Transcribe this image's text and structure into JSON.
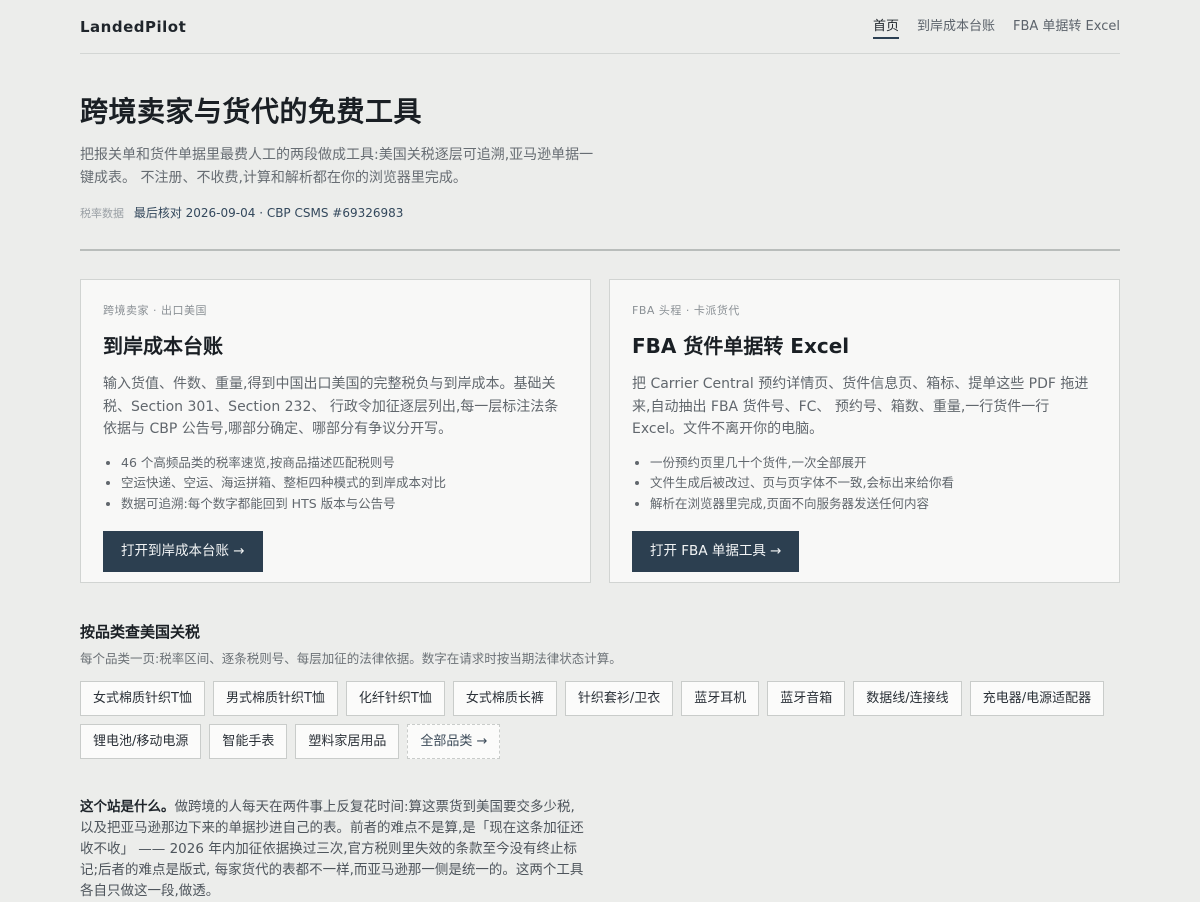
{
  "header": {
    "brand": "LandedPilot",
    "nav": [
      {
        "label": "首页"
      },
      {
        "label": "到岸成本台账"
      },
      {
        "label": "FBA 单据转 Excel"
      }
    ]
  },
  "hero": {
    "title": "跨境卖家与货代的免费工具",
    "lede": "把报关单和货件单据里最费人工的两段做成工具:美国关税逐层可追溯,亚马逊单据一键成表。 不注册、不收费,计算和解析都在你的浏览器里完成。",
    "meta_key": "税率数据",
    "meta_value": "最后核对 2026-09-04 · CBP CSMS #69326983"
  },
  "cards": [
    {
      "eyebrow": "跨境卖家 · 出口美国",
      "title": "到岸成本台账",
      "desc": "输入货值、件数、重量,得到中国出口美国的完整税负与到岸成本。基础关税、Section 301、Section 232、 行政令加征逐层列出,每一层标注法条依据与 CBP 公告号,哪部分确定、哪部分有争议分开写。",
      "bullets": [
        "46 个高频品类的税率速览,按商品描述匹配税则号",
        "空运快递、空运、海运拼箱、整柜四种模式的到岸成本对比",
        "数据可追溯:每个数字都能回到 HTS 版本与公告号"
      ],
      "button": "打开到岸成本台账 →"
    },
    {
      "eyebrow": "FBA 头程 · 卡派货代",
      "title": "FBA 货件单据转 Excel",
      "desc": "把 Carrier Central 预约详情页、货件信息页、箱标、提单这些 PDF 拖进来,自动抽出 FBA 货件号、FC、 预约号、箱数、重量,一行货件一行 Excel。文件不离开你的电脑。",
      "bullets": [
        "一份预约页里几十个货件,一次全部展开",
        "文件生成后被改过、页与页字体不一致,会标出来给你看",
        "解析在浏览器里完成,页面不向服务器发送任何内容"
      ],
      "button": "打开 FBA 单据工具 →"
    }
  ],
  "categories": {
    "title": "按品类查美国关税",
    "subtitle": "每个品类一页:税率区间、逐条税则号、每层加征的法律依据。数字在请求时按当期法律状态计算。",
    "items": [
      "女式棉质针织T恤",
      "男式棉质针织T恤",
      "化纤针织T恤",
      "女式棉质长裤",
      "针织套衫/卫衣",
      "蓝牙耳机",
      "蓝牙音箱",
      "数据线/连接线",
      "充电器/电源适配器",
      "锂电池/移动电源",
      "智能手表",
      "塑料家居用品"
    ],
    "all_label": "全部品类 →"
  },
  "about": {
    "lead": "这个站是什么。",
    "body": "做跨境的人每天在两件事上反复花时间:算这票货到美国要交多少税, 以及把亚马逊那边下来的单据抄进自己的表。前者的难点不是算,是「现在这条加征还收不收」 —— 2026 年内加征依据换过三次,官方税则里失效的条款至今没有终止标记;后者的难点是版式, 每家货代的表都不一样,而亚马逊那一侧是统一的。这两个工具各自只做这一段,做透。"
  }
}
